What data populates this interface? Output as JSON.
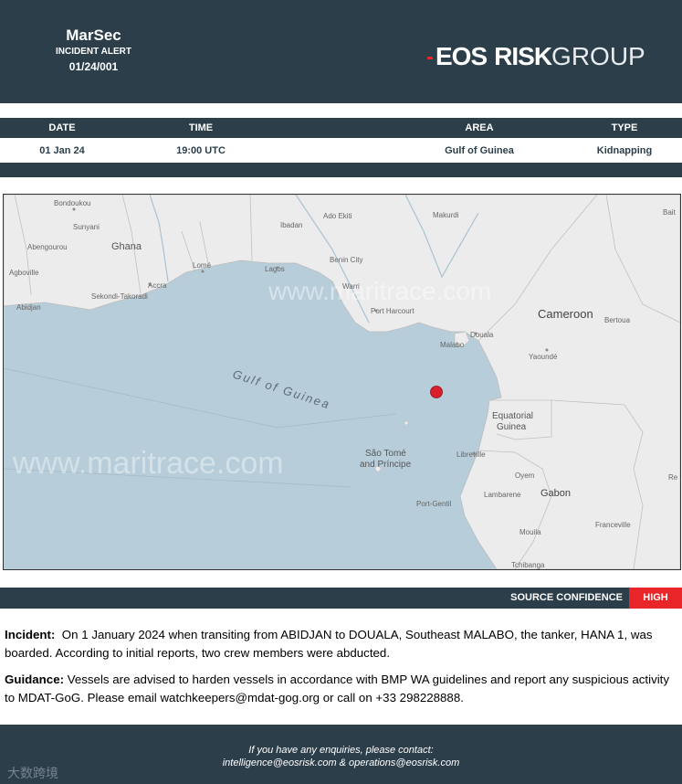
{
  "header": {
    "title": "MarSec",
    "subtitle": "INCIDENT ALERT",
    "alert_id": "01/24/001",
    "logo_part1": "EOS",
    "logo_part2": "RISK",
    "logo_part3": "GROUP"
  },
  "details": {
    "columns": [
      "DATE",
      "TIME",
      "AREA",
      "TYPE"
    ],
    "values": [
      "01 Jan 24",
      "19:00 UTC",
      "Gulf of Guinea",
      "Kidnapping"
    ]
  },
  "map": {
    "watermark": "www.maritrace.com",
    "sea_label": "Gulf of Guinea",
    "countries": [
      "Ghana",
      "Cameroon",
      "Equatorial Guinea",
      "Gabon",
      "Sao Tomé and Principe"
    ],
    "cities": [
      "Bondoukou",
      "Sunyani",
      "Abengourou",
      "Agboville",
      "Abidjan",
      "Sekondi-Takoradi",
      "Accra",
      "Lomé",
      "Lagos",
      "Ibadan",
      "Ado Ekiti",
      "Benin City",
      "Warri",
      "Port Harcourt",
      "Makurdi",
      "Douala",
      "Malabo",
      "Bertoua",
      "Yaoundé",
      "Libreville",
      "Port-Gentil",
      "Lambarene",
      "Franceville",
      "Mouila",
      "Tchibanga",
      "Oyem",
      "Bait",
      "Re the"
    ],
    "incident_color": "#d9202c"
  },
  "confidence": {
    "label": "SOURCE CONFIDENCE",
    "value": "HIGH"
  },
  "incident": {
    "label": "Incident:",
    "text": "On 1 January 2024 when transiting from ABIDJAN to DOUALA, Southeast MALABO, the tanker, HANA 1, was boarded. According to initial reports, two crew members were abducted."
  },
  "guidance": {
    "label": "Guidance:",
    "text": "Vessels are advised to harden vessels in accordance with BMP WA guidelines and report any suspicious activity to MDAT-GoG. Please email watchkeepers@mdat-gog.org or call on +33 298228888."
  },
  "footer": {
    "line1": "If you have any enquiries, please contact:",
    "line2": "intelligence@eosrisk.com & operations@eosrisk.com"
  },
  "watermark": "大数跨境",
  "colors": {
    "dark": "#2c3e4a",
    "accent": "#e8262a",
    "sea": "#b7cdd9",
    "land": "#ececec"
  }
}
